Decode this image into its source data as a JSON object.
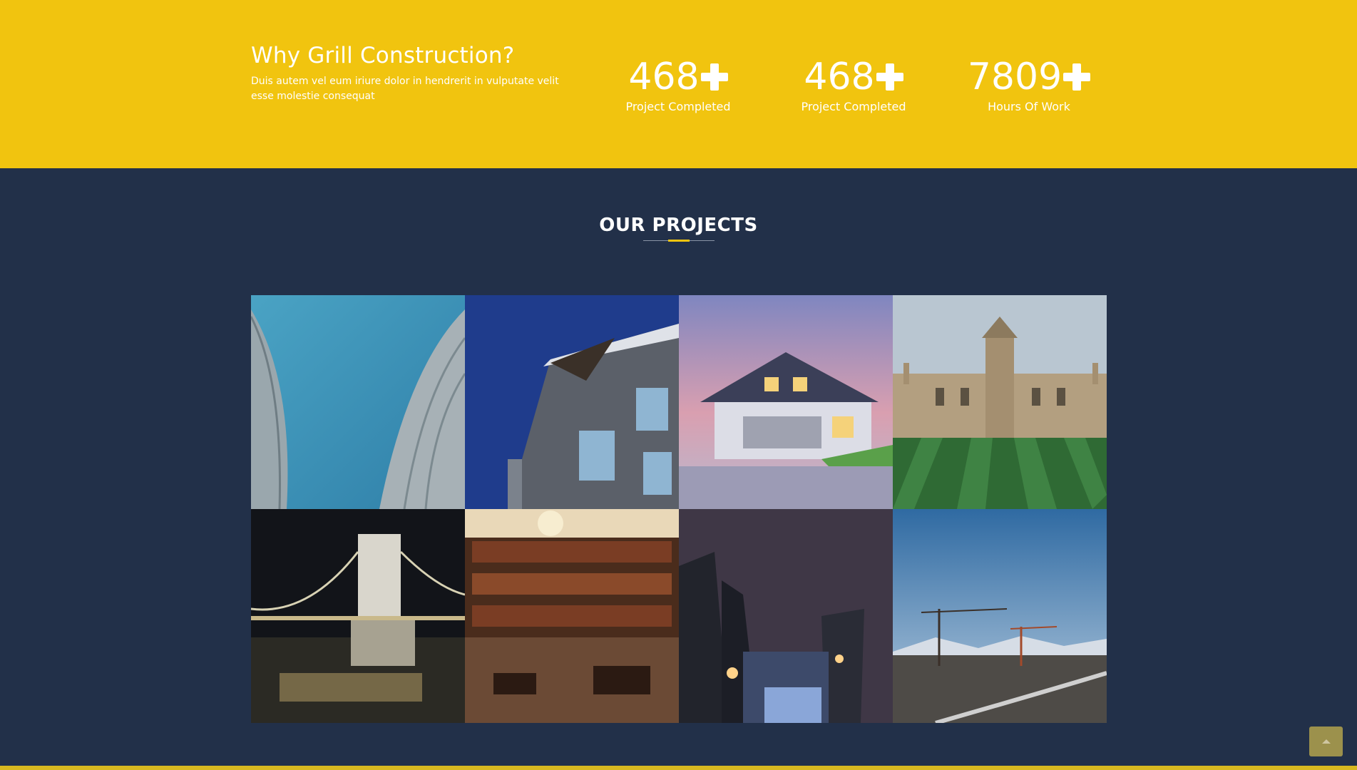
{
  "why": {
    "title": "Why Grill Construction?",
    "text": "Duis autem vel eum iriure dolor in hendrerit in vulputate velit esse molestie consequat"
  },
  "stats": [
    {
      "value": "468",
      "label": "Project Completed"
    },
    {
      "value": "468",
      "label": "Project Completed"
    },
    {
      "value": "7809",
      "label": "Hours Of Work"
    }
  ],
  "projects": {
    "title": "OUR PROJECTS",
    "tiles": [
      "curved-skyscrapers-image",
      "modern-building-facade-image",
      "suburban-house-image",
      "gothic-college-image",
      "chain-bridge-night-image",
      "library-interior-image",
      "power-plant-night-image",
      "city-cranes-image"
    ]
  },
  "colors": {
    "accent": "#f1c40f",
    "background": "#223049",
    "text": "#ffffff"
  },
  "back_to_top_icon": "chevron-up-icon"
}
